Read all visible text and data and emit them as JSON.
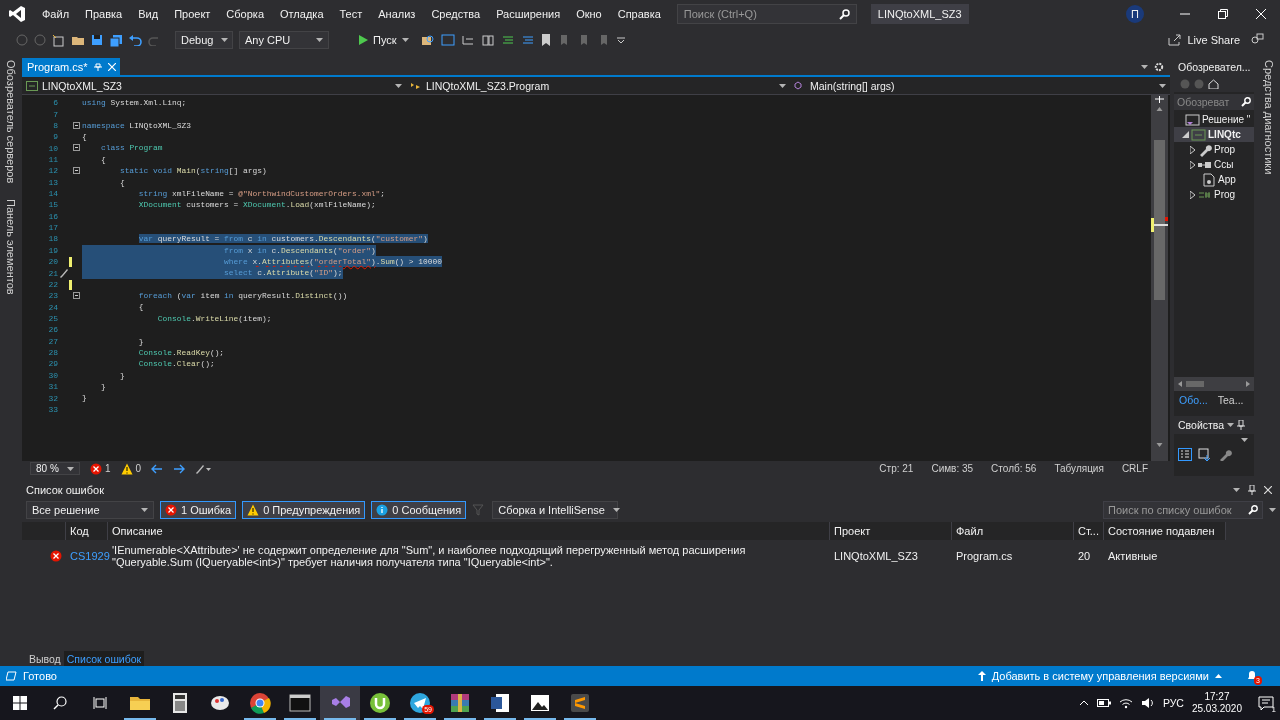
{
  "title_bar": {
    "menu": [
      "Файл",
      "Правка",
      "Вид",
      "Проект",
      "Сборка",
      "Отладка",
      "Тест",
      "Анализ",
      "Средства",
      "Расширения",
      "Окно",
      "Справка"
    ],
    "search": {
      "placeholder": "Поиск (Ctrl+Q)"
    },
    "solution": "LINQtoXML_SZ3",
    "avatar": "П"
  },
  "toolbar": {
    "configuration": "Debug",
    "platform": "Any CPU",
    "start": "Пуск",
    "live_share": "Live Share"
  },
  "side_tabs_left": [
    "Обозреватель серверов",
    "Панель элементов"
  ],
  "side_tabs_right": [
    "Средства диагностики"
  ],
  "editor": {
    "tabs": [
      {
        "label": "Program.cs*",
        "selected": true
      }
    ],
    "nav": [
      "LINQtoXML_SZ3",
      "LINQtoXML_SZ3.Program",
      "Main(string[] args)"
    ],
    "lines": [
      {
        "n": "6",
        "tokens": [
          {
            "t": "using",
            "kind": "kw"
          },
          {
            "t": " System.Xml.Linq;",
            "kind": "pl"
          }
        ],
        "selected": false,
        "changed": false,
        "fold": false,
        "quick_action": false
      },
      {
        "n": "7",
        "changed": false,
        "fold": false,
        "quick_action": false
      },
      {
        "n": "8",
        "tokens": [
          {
            "t": "namespace",
            "kind": "kw"
          },
          {
            "t": " LINQtoXML_SZ3",
            "kind": "pl"
          }
        ],
        "selected": false,
        "changed": false,
        "fold": true,
        "quick_action": false
      },
      {
        "n": "9",
        "tokens": [
          {
            "t": "{",
            "kind": "pl"
          }
        ],
        "selected": false,
        "changed": false,
        "fold": false,
        "quick_action": false
      },
      {
        "n": "10",
        "tokens": [
          {
            "t": "    class ",
            "kind": "kw"
          },
          {
            "t": "Program",
            "kind": "ty"
          }
        ],
        "selected": false,
        "changed": false,
        "fold": true,
        "quick_action": false
      },
      {
        "n": "11",
        "tokens": [
          {
            "t": "    {",
            "kind": "pl"
          }
        ],
        "selected": false,
        "changed": false,
        "fold": false,
        "quick_action": false
      },
      {
        "n": "12",
        "tokens": [
          {
            "t": "        static void ",
            "kind": "kw"
          },
          {
            "t": "Main",
            "kind": "me"
          },
          {
            "t": "(",
            "kind": "pl"
          },
          {
            "t": "string",
            "kind": "kw"
          },
          {
            "t": "[] args)",
            "kind": "pl"
          }
        ],
        "selected": false,
        "changed": false,
        "fold": true,
        "quick_action": false
      },
      {
        "n": "13",
        "tokens": [
          {
            "t": "        {",
            "kind": "pl"
          }
        ],
        "selected": false,
        "changed": false,
        "fold": false,
        "quick_action": false
      },
      {
        "n": "14",
        "tokens": [
          {
            "t": "            string",
            "kind": "kw"
          },
          {
            "t": " xmlFileName = ",
            "kind": "pl"
          },
          {
            "t": "@\"NorthwindCustomerOrders.xml\"",
            "kind": "st"
          },
          {
            "t": ";",
            "kind": "pl"
          }
        ],
        "selected": false,
        "changed": false,
        "fold": false,
        "quick_action": false
      },
      {
        "n": "15",
        "tokens": [
          {
            "t": "            XDocument",
            "kind": "ty"
          },
          {
            "t": " customers = ",
            "kind": "pl"
          },
          {
            "t": "XDocument",
            "kind": "ty"
          },
          {
            "t": ".",
            "kind": "pl"
          },
          {
            "t": "Load",
            "kind": "me"
          },
          {
            "t": "(xmlFileName);",
            "kind": "pl"
          }
        ],
        "selected": false,
        "changed": false,
        "fold": false,
        "quick_action": false
      },
      {
        "n": "16",
        "changed": false,
        "fold": false,
        "quick_action": false
      },
      {
        "n": "17",
        "changed": false,
        "fold": false,
        "quick_action": false
      },
      {
        "n": "18",
        "tokens": [
          {
            "t": "            var",
            "kind": "kw"
          },
          {
            "t": " queryResult = ",
            "kind": "pl"
          },
          {
            "t": "from",
            "kind": "kw"
          },
          {
            "t": " c ",
            "kind": "pl"
          },
          {
            "t": "in",
            "kind": "kw"
          },
          {
            "t": " customers.",
            "kind": "pl"
          },
          {
            "t": "Descendants",
            "kind": "me"
          },
          {
            "t": "(",
            "kind": "pl"
          },
          {
            "t": "\"customer\"",
            "kind": "st"
          },
          {
            "t": ")",
            "kind": "pl"
          }
        ],
        "selected": true,
        "changed": false,
        "fold": false,
        "quick_action": false
      },
      {
        "n": "19",
        "tokens": [
          {
            "t": "                              from",
            "kind": "kw"
          },
          {
            "t": " x ",
            "kind": "pl"
          },
          {
            "t": "in",
            "kind": "kw"
          },
          {
            "t": " c.",
            "kind": "pl"
          },
          {
            "t": "Descendants",
            "kind": "me"
          },
          {
            "t": "(",
            "kind": "pl"
          },
          {
            "t": "\"order\"",
            "kind": "st"
          },
          {
            "t": ")",
            "kind": "pl"
          }
        ],
        "selected": true,
        "changed": false,
        "fold": false,
        "quick_action": false
      },
      {
        "n": "20",
        "tokens": [
          {
            "t": "                              where ",
            "kind": "kw"
          },
          {
            "t": "x.",
            "kind": "pe"
          },
          {
            "t": "Attributes",
            "kind": "me_e"
          },
          {
            "t": "(",
            "kind": "pe"
          },
          {
            "t": "\"orderTotal\"",
            "kind": "st_e"
          },
          {
            "t": ")",
            "kind": "pe"
          },
          {
            "t": ".",
            "kind": "pl"
          },
          {
            "t": "Sum",
            "kind": "me"
          },
          {
            "t": "() > 10000",
            "kind": "pl"
          }
        ],
        "selected": true,
        "changed": true,
        "fold": false,
        "quick_action": false
      },
      {
        "n": "21",
        "tokens": [
          {
            "t": "                              select",
            "kind": "kw"
          },
          {
            "t": " c.",
            "kind": "pl"
          },
          {
            "t": "Attribute",
            "kind": "me"
          },
          {
            "t": "(",
            "kind": "pl"
          },
          {
            "t": "\"ID\"",
            "kind": "st"
          },
          {
            "t": ");",
            "kind": "pl"
          }
        ],
        "selected": true,
        "changed": false,
        "fold": false,
        "quick_action": true
      },
      {
        "n": "22",
        "changed": true,
        "fold": false,
        "quick_action": false
      },
      {
        "n": "23",
        "tokens": [
          {
            "t": "            foreach",
            "kind": "kw"
          },
          {
            "t": " (",
            "kind": "pl"
          },
          {
            "t": "var",
            "kind": "kw"
          },
          {
            "t": " item ",
            "kind": "pl"
          },
          {
            "t": "in",
            "kind": "kw"
          },
          {
            "t": " queryResult.",
            "kind": "pl"
          },
          {
            "t": "Distinct",
            "kind": "me"
          },
          {
            "t": "())",
            "kind": "pl"
          }
        ],
        "selected": false,
        "changed": false,
        "fold": true,
        "quick_action": false
      },
      {
        "n": "24",
        "tokens": [
          {
            "t": "            {",
            "kind": "pl"
          }
        ],
        "selected": false,
        "changed": false,
        "fold": false,
        "quick_action": false
      },
      {
        "n": "25",
        "tokens": [
          {
            "t": "                Console",
            "kind": "ty"
          },
          {
            "t": ".",
            "kind": "pl"
          },
          {
            "t": "WriteLine",
            "kind": "me"
          },
          {
            "t": "(item);",
            "kind": "pl"
          }
        ],
        "selected": false,
        "changed": false,
        "fold": false,
        "quick_action": false
      },
      {
        "n": "26",
        "changed": false,
        "fold": false,
        "quick_action": false
      },
      {
        "n": "27",
        "tokens": [
          {
            "t": "            }",
            "kind": "pl"
          }
        ],
        "selected": false,
        "changed": false,
        "fold": false,
        "quick_action": false
      },
      {
        "n": "28",
        "tokens": [
          {
            "t": "            Console",
            "kind": "ty"
          },
          {
            "t": ".",
            "kind": "pl"
          },
          {
            "t": "ReadKey",
            "kind": "me"
          },
          {
            "t": "();",
            "kind": "pl"
          }
        ],
        "selected": false,
        "changed": false,
        "fold": false,
        "quick_action": false
      },
      {
        "n": "29",
        "tokens": [
          {
            "t": "            Console",
            "kind": "ty"
          },
          {
            "t": ".",
            "kind": "pl"
          },
          {
            "t": "Clear",
            "kind": "me"
          },
          {
            "t": "();",
            "kind": "pl"
          }
        ],
        "selected": false,
        "changed": false,
        "fold": false,
        "quick_action": false
      },
      {
        "n": "30",
        "tokens": [
          {
            "t": "        }",
            "kind": "pl"
          }
        ],
        "selected": false,
        "changed": false,
        "fold": false,
        "quick_action": false
      },
      {
        "n": "31",
        "tokens": [
          {
            "t": "    }",
            "kind": "pl"
          }
        ],
        "selected": false,
        "changed": false,
        "fold": false,
        "quick_action": false
      },
      {
        "n": "32",
        "tokens": [
          {
            "t": "}",
            "kind": "pl"
          }
        ],
        "selected": false,
        "changed": false,
        "fold": false,
        "quick_action": false
      },
      {
        "n": "33",
        "changed": false,
        "fold": false,
        "quick_action": false
      }
    ],
    "status": {
      "zoom": "80 %",
      "errors": "1",
      "warnings": "0",
      "position": [
        "Стр: 21",
        "Симв: 35",
        "Столб: 56",
        "Табуляция",
        "CRLF"
      ]
    }
  },
  "solution_explorer": {
    "title": "Обозревател...",
    "search": {
      "placeholder": "Обозреват"
    },
    "tree": [
      {
        "label": "Решение \"",
        "kind": "solution",
        "selected": false,
        "children": [
          {
            "label": "LINQtc",
            "kind": "project",
            "expanded": true,
            "selected": true,
            "children": [
              {
                "label": "Prop",
                "kind": "properties",
                "expanded": false,
                "selected": false
              },
              {
                "label": "Ссы",
                "kind": "references",
                "expanded": false,
                "selected": false
              },
              {
                "label": "App",
                "kind": "config",
                "selected": false
              },
              {
                "label": "Prog",
                "kind": "csfile",
                "expanded": false,
                "selected": false
              }
            ]
          }
        ]
      }
    ],
    "tabs": [
      {
        "label": "Обо...",
        "selected": true
      },
      {
        "label": "Tea...",
        "selected": false
      }
    ]
  },
  "properties": {
    "title": "Свойства"
  },
  "error_list": {
    "title": "Список ошибок",
    "scope": "Все решение",
    "filters": [
      {
        "kind": "error",
        "label": "1 Ошибка",
        "selected": true
      },
      {
        "kind": "warning",
        "label": "0 Предупреждения",
        "selected": true
      },
      {
        "kind": "info",
        "label": "0 Сообщения",
        "selected": true
      }
    ],
    "source": "Сборка и IntelliSense",
    "search": {
      "placeholder": "Поиск по списку ошибок"
    },
    "columns": [
      "Код",
      "Описание",
      "Проект",
      "Файл",
      "Ст...",
      "Состояние подавлен"
    ],
    "rows": [
      {
        "kind": "error",
        "code": "CS1929",
        "description": "'IEnumerable<XAttribute>' не содержит определение для \"Sum\", и наиболее подходящий перегруженный метод расширения \"Queryable.Sum (IQueryable<int>)\" требует наличия получателя типа \"IQueryable<int>\".",
        "project": "LINQtoXML_SZ3",
        "file": "Program.cs",
        "line": "20",
        "state": "Активные"
      }
    ]
  },
  "bottom_tabs": [
    {
      "label": "Вывод",
      "selected": false
    },
    {
      "label": "Список ошибок",
      "selected": true
    }
  ],
  "status_bar": {
    "text": "Готово",
    "source_control": "Добавить в систему управления версиями",
    "notifications": "3"
  },
  "taskbar": {
    "apps": [
      {
        "kind": "explorer",
        "active": false,
        "running": true
      },
      {
        "kind": "calculator",
        "active": false,
        "running": false
      },
      {
        "kind": "paint",
        "active": false,
        "running": false
      },
      {
        "kind": "browser",
        "active": false,
        "running": true
      },
      {
        "kind": "terminal",
        "active": false,
        "running": true
      },
      {
        "kind": "ide",
        "active": true,
        "running": true
      },
      {
        "kind": "torrent",
        "active": false,
        "running": true
      },
      {
        "kind": "messenger",
        "active": false,
        "running": true,
        "badge": "59"
      },
      {
        "kind": "archiver",
        "active": false,
        "running": true
      },
      {
        "kind": "word",
        "active": false,
        "running": true
      },
      {
        "kind": "photos",
        "active": false,
        "running": true
      },
      {
        "kind": "editor",
        "active": false,
        "running": true
      }
    ],
    "language": "РУС",
    "time": "17:27",
    "date": "25.03.2020",
    "notifications": "1"
  }
}
